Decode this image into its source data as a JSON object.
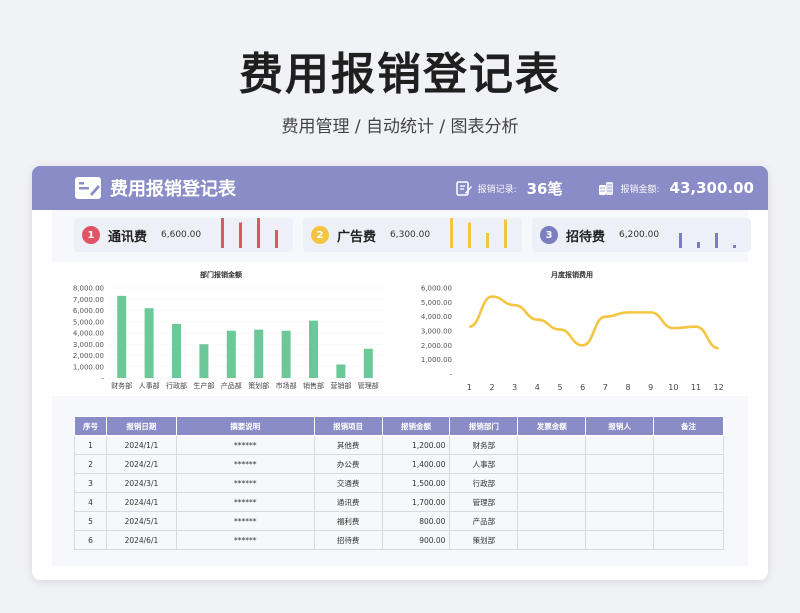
{
  "page": {
    "title": "费用报销登记表",
    "subtitle": "费用管理 / 自动统计 / 图表分析"
  },
  "header": {
    "title": "费用报销登记表",
    "records_label": "报销记录:",
    "records_value": "36笔",
    "amount_label": "报销金额:",
    "amount_value": "43,300.00"
  },
  "categories": [
    {
      "num": "1",
      "name": "通讯费",
      "amount": "6,600.00",
      "color": "#e05566",
      "bars": [
        1.0,
        0.85,
        1.0,
        0.6
      ]
    },
    {
      "num": "2",
      "name": "广告费",
      "amount": "6,300.00",
      "color": "#f4c542",
      "bars": [
        1.0,
        0.85,
        0.5,
        0.95
      ]
    },
    {
      "num": "3",
      "name": "招待费",
      "amount": "6,200.00",
      "color": "#7b7fc0",
      "bars": [
        0.5,
        0.2,
        0.5,
        0.1
      ]
    }
  ],
  "chart_data": [
    {
      "type": "bar",
      "title": "部门报销金额",
      "categories": [
        "财务部",
        "人事部",
        "行政部",
        "生产部",
        "产品部",
        "策划部",
        "市场部",
        "销售部",
        "营销部",
        "管理部"
      ],
      "values": [
        7300,
        6200,
        4800,
        3000,
        4200,
        4300,
        4200,
        5100,
        1200,
        2600
      ],
      "ylim": [
        0,
        8000
      ],
      "yticks": [
        "8,000.00",
        "7,000.00",
        "6,000.00",
        "5,000.00",
        "4,000.00",
        "3,000.00",
        "2,000.00",
        "1,000.00",
        "-"
      ],
      "color": "#6cc799"
    },
    {
      "type": "line",
      "title": "月度报销费用",
      "x": [
        "1",
        "2",
        "3",
        "4",
        "5",
        "6",
        "7",
        "8",
        "9",
        "10",
        "11",
        "12"
      ],
      "values": [
        3300,
        5400,
        4800,
        3800,
        3100,
        2000,
        4000,
        4300,
        4300,
        3200,
        3300,
        1800
      ],
      "ylim": [
        0,
        6000
      ],
      "yticks": [
        "6,000.00",
        "5,000.00",
        "4,000.00",
        "3,000.00",
        "2,000.00",
        "1,000.00",
        "-"
      ],
      "color": "#f4c542"
    }
  ],
  "table": {
    "headers": [
      "序号",
      "报销日期",
      "摘要说明",
      "报销项目",
      "报销金额",
      "报销部门",
      "发票金额",
      "报销人",
      "备注"
    ],
    "rows": [
      [
        "1",
        "2024/1/1",
        "******",
        "其他费",
        "1,200.00",
        "财务部",
        "",
        "",
        ""
      ],
      [
        "2",
        "2024/2/1",
        "******",
        "办公费",
        "1,400.00",
        "人事部",
        "",
        "",
        ""
      ],
      [
        "3",
        "2024/3/1",
        "******",
        "交通费",
        "1,500.00",
        "行政部",
        "",
        "",
        ""
      ],
      [
        "4",
        "2024/4/1",
        "******",
        "通讯费",
        "1,700.00",
        "管理部",
        "",
        "",
        ""
      ],
      [
        "5",
        "2024/5/1",
        "******",
        "福利费",
        "800.00",
        "产品部",
        "",
        "",
        ""
      ],
      [
        "6",
        "2024/6/1",
        "******",
        "招待费",
        "900.00",
        "策划部",
        "",
        "",
        ""
      ]
    ]
  },
  "colors": {
    "header": "#8a8cc7",
    "bar": "#6cc799",
    "line": "#f4c542"
  }
}
